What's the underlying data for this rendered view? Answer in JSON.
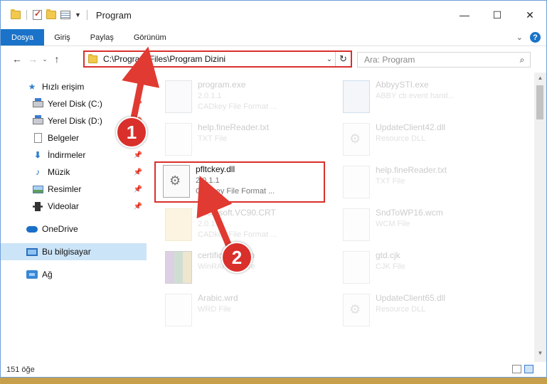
{
  "title": "Program",
  "ribbon": {
    "file": "Dosya",
    "tabs": [
      "Giriş",
      "Paylaş",
      "Görünüm"
    ]
  },
  "address": {
    "path": "C:\\Program Files\\Program Dizini"
  },
  "search": {
    "placeholder": "Ara: Program"
  },
  "sidebar": {
    "quick_access": "Hızlı erişim",
    "items": [
      "Yerel Disk (C:)",
      "Yerel Disk (D:)",
      "Belgeler",
      "İndirmeler",
      "Müzik",
      "Resimler",
      "Videolar"
    ],
    "onedrive": "OneDrive",
    "thispc": "Bu bilgisayar",
    "network": "Ağ"
  },
  "files": [
    {
      "name": "program.exe",
      "line2": "2.0.1.1",
      "line3": "CADkey File Format ..."
    },
    {
      "name": "AbbyySTI.exe",
      "line2": "ABBY cb event hand...",
      "line3": ""
    },
    {
      "name": "help.fineReader.txt",
      "line2": "TXT File",
      "line3": ""
    },
    {
      "name": "UpdateClient42.dll",
      "line2": "Resource DLL",
      "line3": ""
    },
    {
      "name": "pfltckey.dll",
      "line2": "2.0.1.1",
      "line3": "CADkey File Format ..."
    },
    {
      "name": "help.fineReader.txt",
      "line2": "TXT File",
      "line3": ""
    },
    {
      "name": "Microsoft.VC90.CRT",
      "line2": "2.0.1.1",
      "line3": "CADkey File Format ..."
    },
    {
      "name": "SndToWP16.wcm",
      "line2": "WCM File",
      "line3": ""
    },
    {
      "name": "certificates.cab",
      "line2": "WinRAR archive",
      "line3": ""
    },
    {
      "name": "gtd.cjk",
      "line2": "CJK File",
      "line3": ""
    },
    {
      "name": "Arabic.wrd",
      "line2": "WRD File",
      "line3": ""
    },
    {
      "name": "UpdateClient65.dll",
      "line2": "Resource DLL",
      "line3": ""
    }
  ],
  "status": {
    "count": "151 öğe"
  },
  "annotations": {
    "step1": "1",
    "step2": "2"
  },
  "colors": {
    "accent": "#1a73c8",
    "highlight": "#d9302c"
  }
}
